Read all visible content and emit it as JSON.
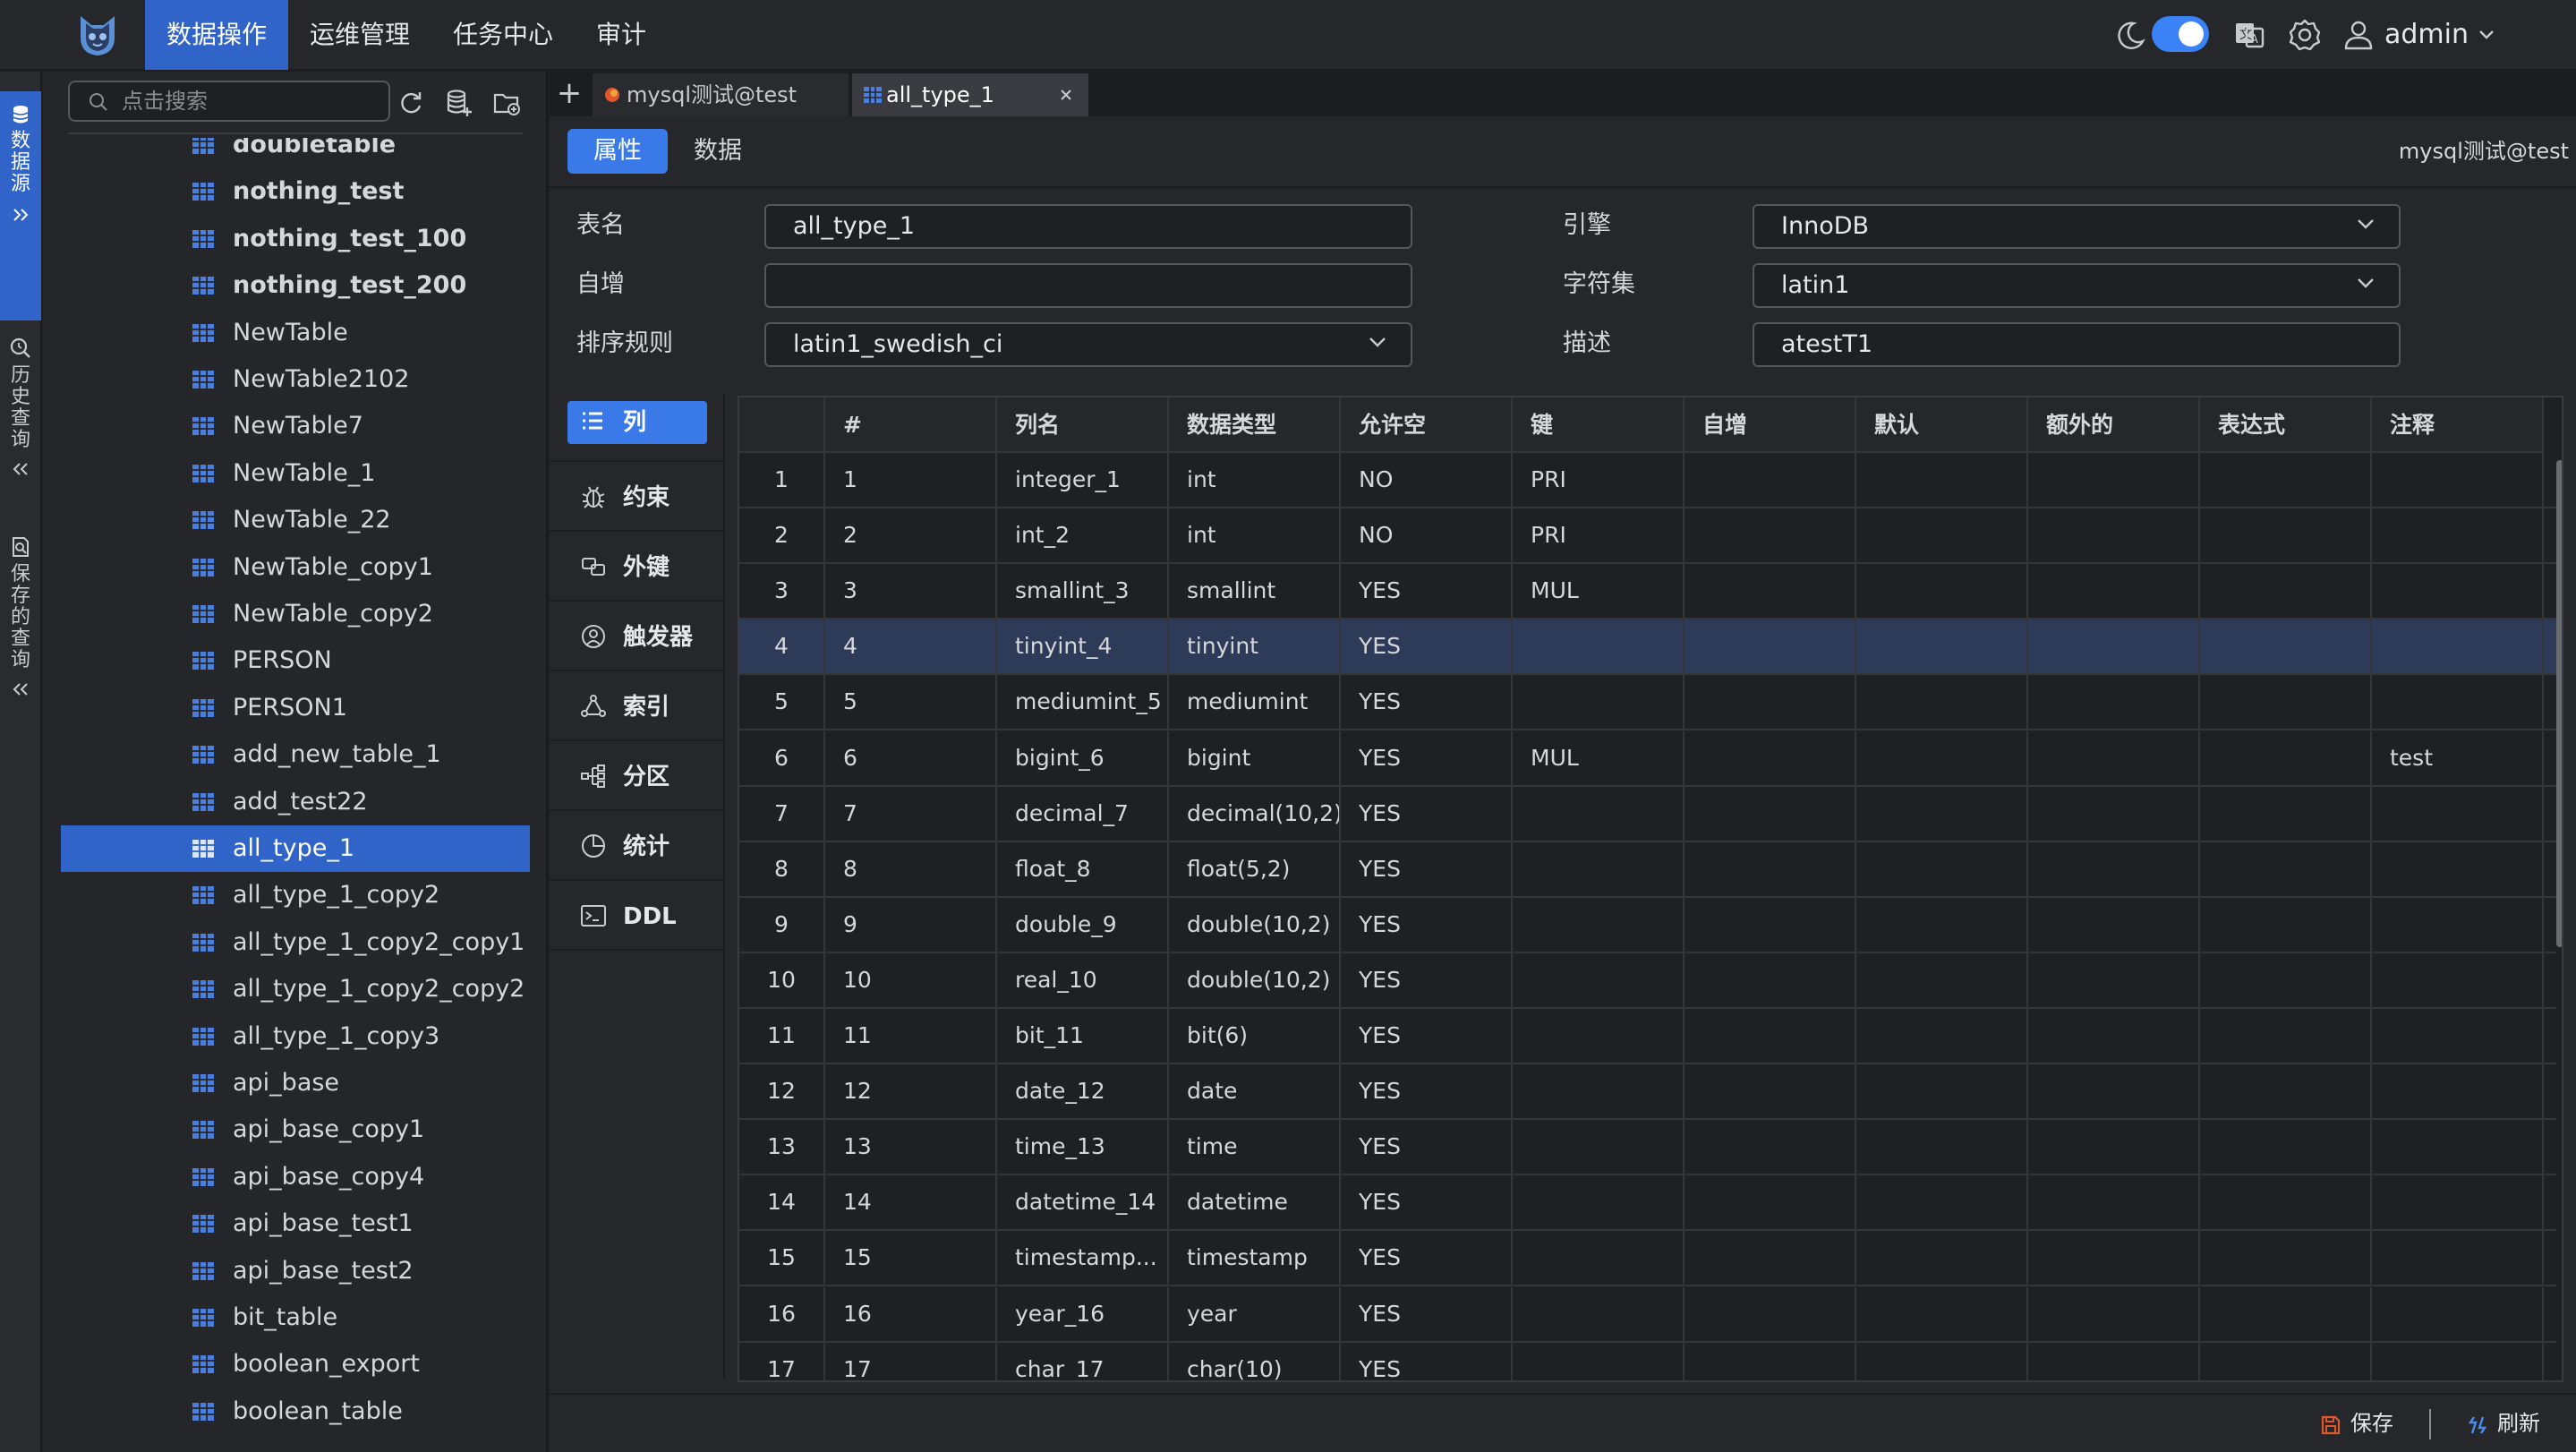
{
  "topnav": {
    "items": [
      {
        "label": "数据操作",
        "active": true
      },
      {
        "label": "运维管理",
        "active": false
      },
      {
        "label": "任务中心",
        "active": false
      },
      {
        "label": "审计",
        "active": false
      }
    ],
    "dark_mode_on": true,
    "user": "admin"
  },
  "vtabs": [
    {
      "label": "数据源",
      "icon": "database-icon",
      "active": true
    },
    {
      "label": "历史查询",
      "icon": "history-search-icon",
      "active": false
    },
    {
      "label": "保存的查询",
      "icon": "saved-query-icon",
      "active": false
    }
  ],
  "tree": {
    "search_placeholder": "点击搜索",
    "items": [
      {
        "label": "doubletable",
        "bold": true
      },
      {
        "label": "nothing_test",
        "bold": true
      },
      {
        "label": "nothing_test_100",
        "bold": true
      },
      {
        "label": "nothing_test_200",
        "bold": true
      },
      {
        "label": "NewTable",
        "bold": false
      },
      {
        "label": "NewTable2102",
        "bold": false
      },
      {
        "label": "NewTable7",
        "bold": false
      },
      {
        "label": "NewTable_1",
        "bold": false
      },
      {
        "label": "NewTable_22",
        "bold": false
      },
      {
        "label": "NewTable_copy1",
        "bold": false
      },
      {
        "label": "NewTable_copy2",
        "bold": false
      },
      {
        "label": "PERSON",
        "bold": false
      },
      {
        "label": "PERSON1",
        "bold": false
      },
      {
        "label": "add_new_table_1",
        "bold": false
      },
      {
        "label": "add_test22",
        "bold": false
      },
      {
        "label": "all_type_1",
        "bold": false,
        "selected": true
      },
      {
        "label": "all_type_1_copy2",
        "bold": false
      },
      {
        "label": "all_type_1_copy2_copy1",
        "bold": false
      },
      {
        "label": "all_type_1_copy2_copy2",
        "bold": false
      },
      {
        "label": "all_type_1_copy3",
        "bold": false
      },
      {
        "label": "api_base",
        "bold": false
      },
      {
        "label": "api_base_copy1",
        "bold": false
      },
      {
        "label": "api_base_copy4",
        "bold": false
      },
      {
        "label": "api_base_test1",
        "bold": false
      },
      {
        "label": "api_base_test2",
        "bold": false
      },
      {
        "label": "bit_table",
        "bold": false
      },
      {
        "label": "boolean_export",
        "bold": false
      },
      {
        "label": "boolean_table",
        "bold": false
      }
    ]
  },
  "tabs": [
    {
      "label": "mysql测试@test",
      "active": false,
      "icon": "mysql-icon"
    },
    {
      "label": "all_type_1",
      "active": true,
      "icon": "table-icon",
      "closable": true
    }
  ],
  "subtabs": [
    {
      "label": "属性",
      "active": true
    },
    {
      "label": "数据",
      "active": false
    }
  ],
  "connection": "mysql测试@test",
  "form": {
    "table_name": {
      "label": "表名",
      "value": "all_type_1"
    },
    "engine": {
      "label": "引擎",
      "value": "InnoDB"
    },
    "auto_increment": {
      "label": "自增",
      "value": ""
    },
    "charset": {
      "label": "字符集",
      "value": "latin1"
    },
    "collation": {
      "label": "排序规则",
      "value": "latin1_swedish_ci"
    },
    "description": {
      "label": "描述",
      "value": "atestT1"
    }
  },
  "sidemenu": [
    {
      "label": "列",
      "icon": "list-icon",
      "active": true
    },
    {
      "label": "约束",
      "icon": "bug-icon",
      "active": false
    },
    {
      "label": "外键",
      "icon": "link-icon",
      "active": false
    },
    {
      "label": "触发器",
      "icon": "trigger-icon",
      "active": false
    },
    {
      "label": "索引",
      "icon": "index-icon",
      "active": false
    },
    {
      "label": "分区",
      "icon": "partition-icon",
      "active": false
    },
    {
      "label": "统计",
      "icon": "stats-icon",
      "active": false
    },
    {
      "label": "DDL",
      "icon": "terminal-icon",
      "active": false
    }
  ],
  "columns_table": {
    "headers": [
      "",
      "#",
      "列名",
      "数据类型",
      "允许空",
      "键",
      "自增",
      "默认",
      "额外的",
      "表达式",
      "注释"
    ],
    "rows": [
      [
        "1",
        "1",
        "integer_1",
        "int",
        "NO",
        "PRI",
        "",
        "",
        "",
        "",
        ""
      ],
      [
        "2",
        "2",
        "int_2",
        "int",
        "NO",
        "PRI",
        "",
        "",
        "",
        "",
        ""
      ],
      [
        "3",
        "3",
        "smallint_3",
        "smallint",
        "YES",
        "MUL",
        "",
        "",
        "",
        "",
        ""
      ],
      [
        "4",
        "4",
        "tinyint_4",
        "tinyint",
        "YES",
        "",
        "",
        "",
        "",
        "",
        ""
      ],
      [
        "5",
        "5",
        "mediumint_5",
        "mediumint",
        "YES",
        "",
        "",
        "",
        "",
        "",
        ""
      ],
      [
        "6",
        "6",
        "bigint_6",
        "bigint",
        "YES",
        "MUL",
        "",
        "",
        "",
        "",
        "test"
      ],
      [
        "7",
        "7",
        "decimal_7",
        "decimal(10,2)",
        "YES",
        "",
        "",
        "",
        "",
        "",
        ""
      ],
      [
        "8",
        "8",
        "float_8",
        "float(5,2)",
        "YES",
        "",
        "",
        "",
        "",
        "",
        ""
      ],
      [
        "9",
        "9",
        "double_9",
        "double(10,2)",
        "YES",
        "",
        "",
        "",
        "",
        "",
        ""
      ],
      [
        "10",
        "10",
        "real_10",
        "double(10,2)",
        "YES",
        "",
        "",
        "",
        "",
        "",
        ""
      ],
      [
        "11",
        "11",
        "bit_11",
        "bit(6)",
        "YES",
        "",
        "",
        "",
        "",
        "",
        ""
      ],
      [
        "12",
        "12",
        "date_12",
        "date",
        "YES",
        "",
        "",
        "",
        "",
        "",
        ""
      ],
      [
        "13",
        "13",
        "time_13",
        "time",
        "YES",
        "",
        "",
        "",
        "",
        "",
        ""
      ],
      [
        "14",
        "14",
        "datetime_14",
        "datetime",
        "YES",
        "",
        "",
        "",
        "",
        "",
        ""
      ],
      [
        "15",
        "15",
        "timestamp...",
        "timestamp",
        "YES",
        "",
        "",
        "",
        "",
        "",
        ""
      ],
      [
        "16",
        "16",
        "year_16",
        "year",
        "YES",
        "",
        "",
        "",
        "",
        "",
        ""
      ],
      [
        "17",
        "17",
        "char_17",
        "char(10)",
        "YES",
        "",
        "",
        "",
        "",
        "",
        ""
      ]
    ],
    "selected_row": 3
  },
  "footer": {
    "save_label": "保存",
    "refresh_label": "刷新"
  },
  "colors": {
    "accent": "#3064c8",
    "accent_light": "#3a7ae8",
    "selected_row": "#2d3a58",
    "background": "#1e1f22",
    "save_icon": "#e0572c",
    "refresh_icon": "#4a8cf0"
  }
}
